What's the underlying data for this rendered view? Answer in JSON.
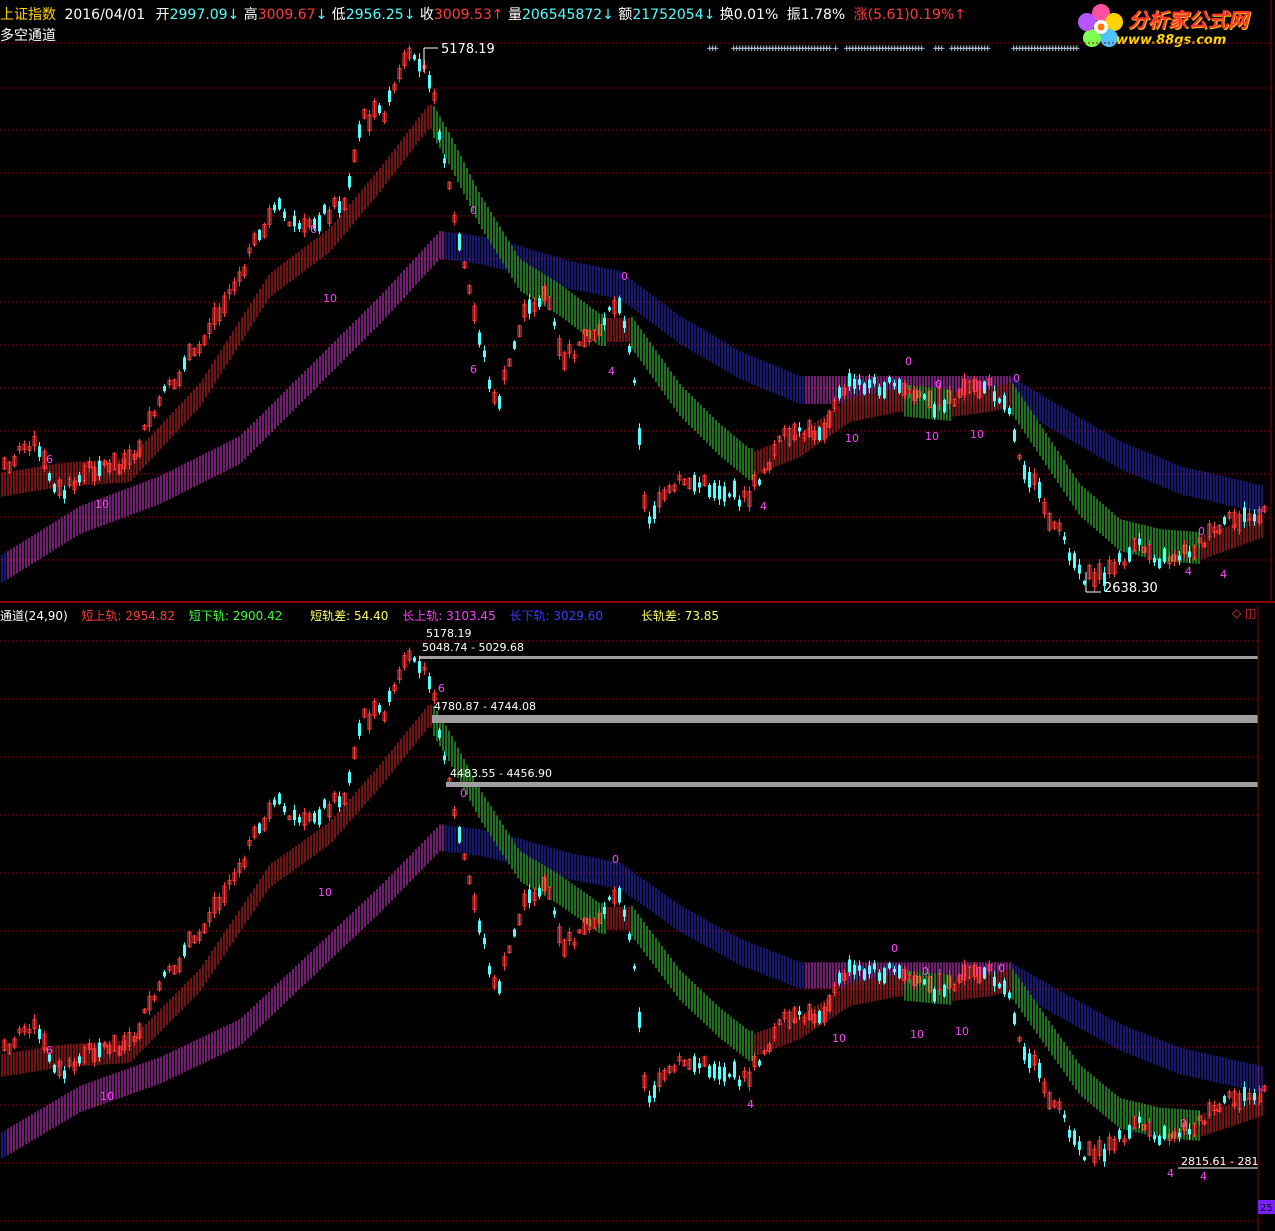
{
  "header": {
    "index_name": "上证指数",
    "date": "2016/04/01",
    "open_label": "开",
    "open": "2997.09",
    "open_arrow": "↓",
    "high_label": "高",
    "high": "3009.67",
    "high_arrow": "↓",
    "low_label": "低",
    "low": "2956.25",
    "low_arrow": "↓",
    "close_label": "收",
    "close": "3009.53",
    "close_arrow": "↑",
    "volume_label": "量",
    "volume": "206545872",
    "volume_arrow": "↓",
    "amount_label": "额",
    "amount": "21752054",
    "amount_arrow": "↓",
    "turnover": "换0.01%",
    "amplitude": "振1.78%",
    "change": "涨(5.61)0.19%↑"
  },
  "subtitle": "多空通道",
  "logo": {
    "title": "分析家公式网",
    "url": "www.88gs.com"
  },
  "indicator": {
    "name": "通道(24,90)",
    "short_upper": "短上轨: 2954.82",
    "short_lower": "短下轨: 2900.42",
    "short_diff": "短轨差: 54.40",
    "long_upper": "长上轨: 3103.45",
    "long_lower": "长下轨: 3029.60",
    "long_diff": "长轨差: 73.85"
  },
  "top_panel": {
    "high_label": "5178.19",
    "low_label": "2638.30",
    "markers": [
      {
        "text": "6"
      },
      {
        "text": "10"
      },
      {
        "text": "6"
      },
      {
        "text": "0"
      },
      {
        "text": "10"
      },
      {
        "text": "6"
      },
      {
        "text": "4"
      },
      {
        "text": "0"
      },
      {
        "text": "4"
      },
      {
        "text": "0"
      },
      {
        "text": "0"
      },
      {
        "text": "10"
      },
      {
        "text": "10"
      },
      {
        "text": "10"
      },
      {
        "text": "0"
      },
      {
        "text": "0"
      },
      {
        "text": "4"
      },
      {
        "text": "4"
      }
    ]
  },
  "bottom_panel": {
    "high_label": "5178.19",
    "zones": [
      "5048.74 - 5029.68",
      "4780.87 - 4744.08",
      "4483.55 - 4456.90"
    ],
    "low_label": "2815.61 - 281",
    "markers": [
      {
        "text": "6"
      },
      {
        "text": "10"
      },
      {
        "text": "6"
      },
      {
        "text": "0"
      },
      {
        "text": "10"
      },
      {
        "text": "0"
      },
      {
        "text": "4"
      },
      {
        "text": "0"
      },
      {
        "text": "0"
      },
      {
        "text": "10"
      },
      {
        "text": "10"
      },
      {
        "text": "10"
      },
      {
        "text": "0"
      },
      {
        "text": "0"
      },
      {
        "text": "4"
      },
      {
        "text": "4"
      }
    ],
    "corner_value": "25"
  },
  "colors": {
    "background": "#000000",
    "grid": "#8b0000",
    "up_candle": "#ff3b3b",
    "down_candle": "#54ffff",
    "short_band_up": "#ff2a2a",
    "short_band_down": "#3cff3c",
    "long_band_up": "#ff3cff",
    "long_band_down": "#3232ff",
    "marker": "#ff44ff",
    "zone_line": "#a0a0a0"
  }
}
